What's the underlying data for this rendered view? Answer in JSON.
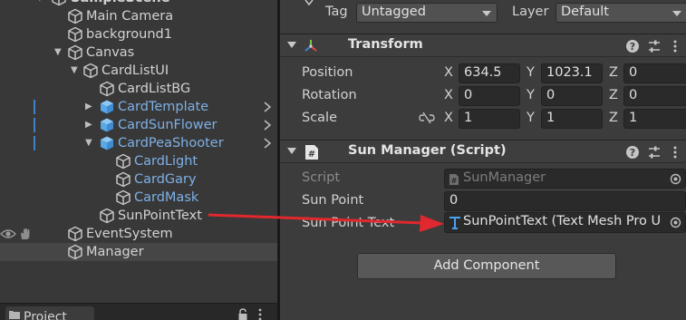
{
  "hierarchy": {
    "scene_name": "SampleScene",
    "items": [
      {
        "label": "Main Camera"
      },
      {
        "label": "background1"
      },
      {
        "label": "Canvas"
      },
      {
        "label": "CardListUI"
      },
      {
        "label": "CardListBG"
      },
      {
        "label": "CardTemplate"
      },
      {
        "label": "CardSunFlower"
      },
      {
        "label": "CardPeaShooter"
      },
      {
        "label": "CardLight"
      },
      {
        "label": "CardGary"
      },
      {
        "label": "CardMask"
      },
      {
        "label": "SunPointText"
      },
      {
        "label": "EventSystem"
      },
      {
        "label": "Manager"
      }
    ]
  },
  "project_panel": {
    "tab_label": "Project"
  },
  "inspector": {
    "tag_label": "Tag",
    "tag_value": "Untagged",
    "layer_label": "Layer",
    "layer_value": "Default",
    "transform": {
      "title": "Transform",
      "position_label": "Position",
      "rotation_label": "Rotation",
      "scale_label": "Scale",
      "axes": [
        "X",
        "Y",
        "Z"
      ],
      "position": [
        "634.5",
        "1023.1",
        "0"
      ],
      "rotation": [
        "0",
        "0",
        "0"
      ],
      "scale": [
        "1",
        "1",
        "1"
      ]
    },
    "sun_manager": {
      "title": "Sun Manager (Script)",
      "script_label": "Script",
      "script_value": "SunManager",
      "sun_point_label": "Sun Point",
      "sun_point_value": "0",
      "sun_point_text_label": "Sun Point Text",
      "sun_point_text_value": "SunPointText (Text Mesh Pro U"
    },
    "add_component_label": "Add Component"
  },
  "colors": {
    "panel_bg": "#383838",
    "inspector_bg": "#3c3c3c",
    "prefab_text": "#7eb0e6",
    "arrow_red": "#e0282e",
    "selection_bg": "#464646"
  }
}
